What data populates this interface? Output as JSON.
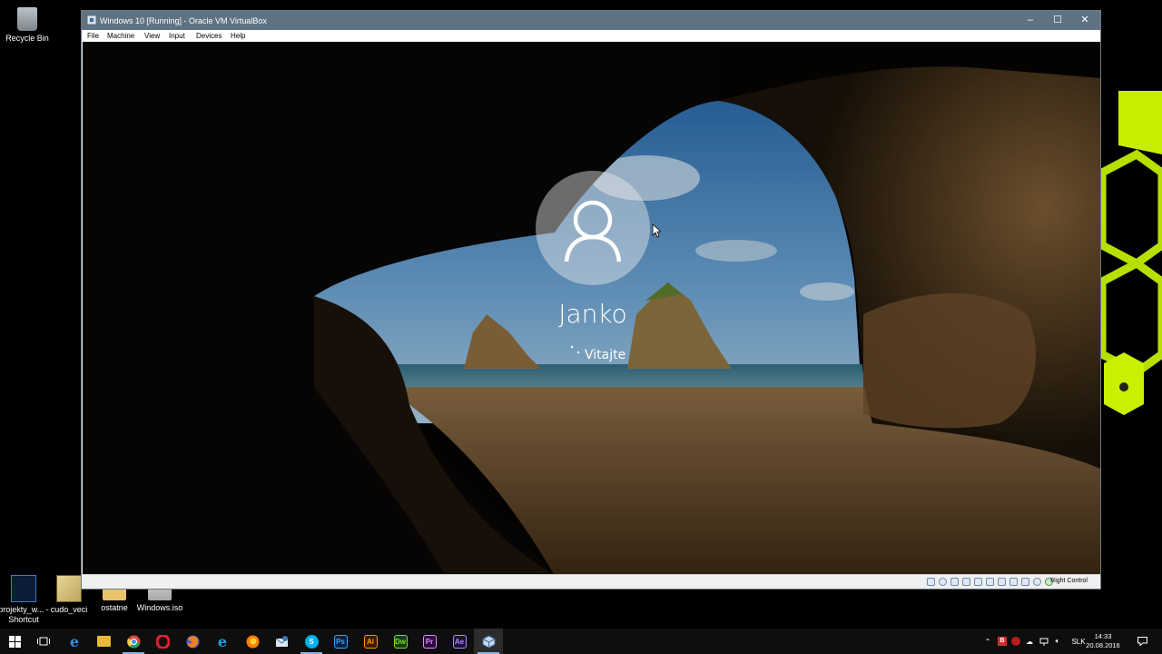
{
  "desktop": {
    "icons": [
      {
        "label": "Recycle Bin",
        "icon": "recycle-bin-icon"
      },
      {
        "label": "projekty_w... - Shortcut",
        "icon": "shortcut-icon"
      },
      {
        "label": "cudo_veci",
        "icon": "file-icon"
      },
      {
        "label": "ostatne",
        "icon": "folder-icon"
      },
      {
        "label": "Windows.iso",
        "icon": "iso-icon"
      }
    ]
  },
  "vbox": {
    "title": "Windows 10 [Running] - Oracle VM VirtualBox",
    "menu": [
      "File",
      "Machine",
      "View",
      "Input",
      "Devices",
      "Help"
    ],
    "window_buttons": {
      "minimize": "–",
      "maximize": "☐",
      "close": "✕"
    },
    "status": {
      "host_key": "Right Control"
    }
  },
  "lockscreen": {
    "username": "Janko",
    "status_text": "Vitajte"
  },
  "taskbar": {
    "apps": [
      {
        "name": "Task View",
        "icon": "task-view-icon"
      },
      {
        "name": "Edge",
        "icon": "edge-icon",
        "color": "#2f7de1",
        "letter": "e"
      },
      {
        "name": "File Explorer",
        "icon": "folder-icon",
        "color": "#f0c040",
        "letter": ""
      },
      {
        "name": "Chrome",
        "icon": "chrome-icon",
        "color": "#dd4b39",
        "letter": ""
      },
      {
        "name": "Opera",
        "icon": "opera-icon",
        "color": "#e3202e",
        "letter": "O"
      },
      {
        "name": "Firefox",
        "icon": "firefox-icon",
        "color": "#e66000",
        "letter": ""
      },
      {
        "name": "Internet Explorer",
        "icon": "ie-icon",
        "color": "#1ea2dd",
        "letter": "e"
      },
      {
        "name": "Firefox",
        "icon": "firefox-icon",
        "color": "#ff7f00",
        "letter": ""
      },
      {
        "name": "Thunderbird",
        "icon": "thunderbird-icon",
        "color": "#3c78b5",
        "letter": ""
      },
      {
        "name": "Skype",
        "icon": "skype-icon",
        "color": "#00aff0",
        "letter": "S"
      },
      {
        "name": "Photoshop",
        "icon": "photoshop-icon",
        "color": "#0b2140",
        "letter": "Ps"
      },
      {
        "name": "Illustrator",
        "icon": "illustrator-icon",
        "color": "#3e1b00",
        "letter": "Ai"
      },
      {
        "name": "Dreamweaver",
        "icon": "dreamweaver-icon",
        "color": "#1d3a12",
        "letter": "Dw"
      },
      {
        "name": "Premiere",
        "icon": "premiere-icon",
        "color": "#2a0c3c",
        "letter": "Pr"
      },
      {
        "name": "After Effects",
        "icon": "after-effects-icon",
        "color": "#1a0f3a",
        "letter": "Ae"
      },
      {
        "name": "VirtualBox",
        "icon": "virtualbox-icon",
        "color": "#3d6fa8",
        "letter": ""
      }
    ],
    "tray": {
      "language": "SLK",
      "time": "14:33",
      "date": "20.08.2016"
    }
  }
}
